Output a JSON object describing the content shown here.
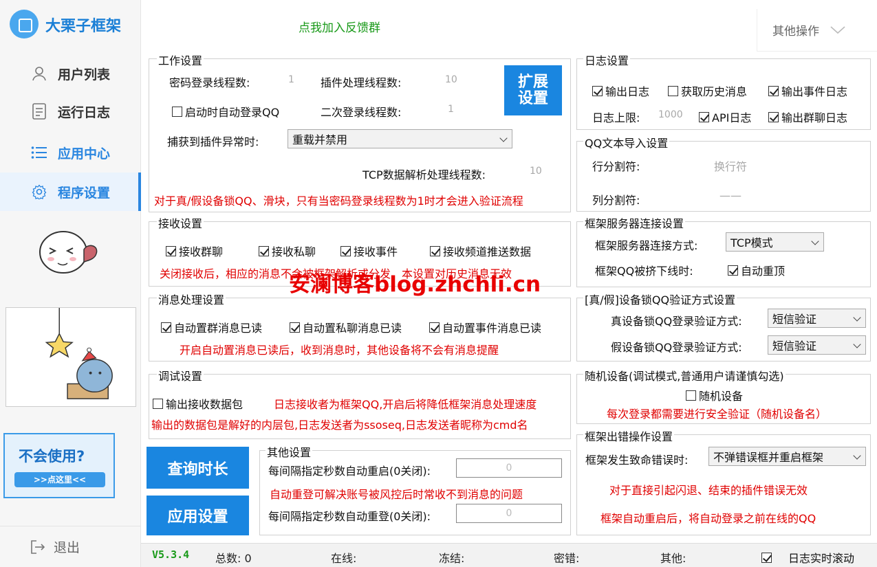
{
  "app": {
    "title": "大栗子框架"
  },
  "sidebar": {
    "items": [
      {
        "label": "用户列表"
      },
      {
        "label": "运行日志"
      },
      {
        "label": "应用中心"
      },
      {
        "label": "程序设置"
      }
    ],
    "help_title": "不会使用?",
    "help_button": ">>点这里<<",
    "logout": "退出"
  },
  "top": {
    "feedback_link": "点我加入反馈群",
    "other_ops": "其他操作"
  },
  "work": {
    "title": "工作设置",
    "pwd_threads_label": "密码登录线程数:",
    "pwd_threads_value": "1",
    "plugin_threads_label": "插件处理线程数:",
    "plugin_threads_value": "10",
    "auto_login_label": "启动时自动登录QQ",
    "second_login_label": "二次登录线程数:",
    "second_login_value": "1",
    "plugin_exception_label": "捕获到插件异常时:",
    "plugin_exception_value": "重载并禁用",
    "tcp_threads_label": "TCP数据解析处理线程数:",
    "tcp_threads_value": "10",
    "note": "对于真/假设备锁QQ、滑块，只有当密码登录线程数为1时才会进入验证流程",
    "expand_button_line1": "扩展",
    "expand_button_line2": "设置"
  },
  "receive": {
    "title": "接收设置",
    "group": "接收群聊",
    "private": "接收私聊",
    "event": "接收事件",
    "channel": "接收频道推送数据",
    "note": "关闭接收后，相应的消息不会被框架解析或分发，本设置对历史消息无效"
  },
  "msgproc": {
    "title": "消息处理设置",
    "group_read": "自动置群消息已读",
    "private_read": "自动置私聊消息已读",
    "event_read": "自动置事件消息已读",
    "note": "开启自动置消息已读后，收到消息时，其他设备将不会有消息提醒"
  },
  "debug": {
    "title": "调试设置",
    "output_packet": "输出接收数据包",
    "note1": "日志接收者为框架QQ,开启后将降低框架消息处理速度",
    "note2": "输出的数据包是解好的内层包,日志发送者为ssoseq,日志发送者昵称为cmd名"
  },
  "buttons": {
    "query": "查询时长",
    "apply": "应用设置"
  },
  "other": {
    "title": "其他设置",
    "restart_label": "每间隔指定秒数自动重启(0关闭):",
    "restart_value": "0",
    "note": "自动重登可解决账号被风控后时常收不到消息的问题",
    "relogin_label": "每间隔指定秒数自动重登(0关闭):",
    "relogin_value": "0"
  },
  "log": {
    "title": "日志设置",
    "output_log": "输出日志",
    "history": "获取历史消息",
    "event_log": "输出事件日志",
    "limit_label": "日志上限:",
    "limit_value": "1000",
    "api_log": "API日志",
    "group_log": "输出群聊日志"
  },
  "qqtext": {
    "title": "QQ文本导入设置",
    "row_sep_label": "行分割符:",
    "row_sep_value": "换行符",
    "col_sep_label": "列分割符:",
    "col_sep_value": "——"
  },
  "server": {
    "title": "框架服务器连接设置",
    "mode_label": "框架服务器连接方式:",
    "mode_value": "TCP模式",
    "kicked_label": "框架QQ被挤下线时:",
    "kicked_option": "自动重顶"
  },
  "devlock": {
    "title": "[真/假]设备锁QQ验证方式设置",
    "real_label": "真设备锁QQ登录验证方式:",
    "real_value": "短信验证",
    "fake_label": "假设备锁QQ登录验证方式:",
    "fake_value": "短信验证"
  },
  "random": {
    "title": "随机设备(调试模式,普通用户请谨慎勾选)",
    "option": "随机设备",
    "note": "每次登录都需要进行安全验证（随机设备名）"
  },
  "error": {
    "title": "框架出错操作设置",
    "fatal_label": "框架发生致命错误时:",
    "fatal_value": "不弹错误框并重启框架",
    "note1": "对于直接引起闪退、结束的插件错误无效",
    "note2": "框架自动重启后，将自动登录之前在线的QQ"
  },
  "watermark": "安澜博客blog.zhchli.cn",
  "status": {
    "version": "V5.3.4",
    "total": "总数: 0",
    "online": "在线:",
    "frozen": "冻结:",
    "pwd_error": "密错:",
    "other": "其他:",
    "realtime_scroll": "日志实时滚动"
  }
}
